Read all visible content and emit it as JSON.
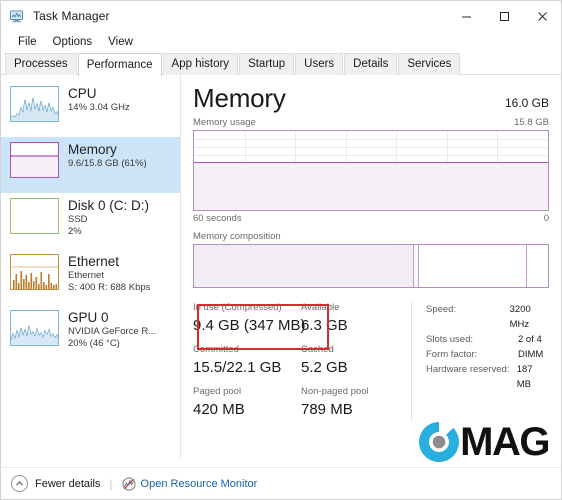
{
  "window": {
    "title": "Task Manager",
    "icon": "task-manager-icon",
    "minimize": "─",
    "maximize": "☐",
    "close": "✕"
  },
  "menu": [
    "File",
    "Options",
    "View"
  ],
  "tabs": [
    {
      "label": "Processes",
      "active": false
    },
    {
      "label": "Performance",
      "active": true
    },
    {
      "label": "App history",
      "active": false
    },
    {
      "label": "Startup",
      "active": false
    },
    {
      "label": "Users",
      "active": false
    },
    {
      "label": "Details",
      "active": false
    },
    {
      "label": "Services",
      "active": false
    }
  ],
  "sidebar": {
    "items": [
      {
        "title": "CPU",
        "lines": [
          "14%  3.04 GHz"
        ],
        "color": "#3f8fc4",
        "selected": false,
        "graph": "line"
      },
      {
        "title": "Memory",
        "lines": [
          "9.6/15.8 GB (61%)"
        ],
        "color": "#a855b7",
        "selected": true,
        "graph": "memory"
      },
      {
        "title": "Disk 0 (C: D:)",
        "lines": [
          "SSD",
          "2%"
        ],
        "color": "#6aa84f",
        "selected": false,
        "graph": "empty"
      },
      {
        "title": "Ethernet",
        "lines": [
          "Ethernet",
          "S: 400 R: 688 Kbps"
        ],
        "color": "#c07a2c",
        "selected": false,
        "graph": "spikes"
      },
      {
        "title": "GPU 0",
        "lines": [
          "NVIDIA GeForce R...",
          "20%  (46 °C)"
        ],
        "color": "#3f8fc4",
        "selected": false,
        "graph": "line"
      }
    ]
  },
  "main": {
    "title": "Memory",
    "capacity": "16.0 GB",
    "usage_graph": {
      "label": "Memory usage",
      "max": "15.8 GB",
      "axis_left": "60 seconds",
      "axis_right": "0",
      "fill_percent": 61
    },
    "composition": {
      "label": "Memory composition",
      "segments": [
        {
          "name": "in-use",
          "percent": 62.0,
          "color": "#f2edf5"
        },
        {
          "name": "modified",
          "percent": 1.0,
          "color": "#faf7fb"
        },
        {
          "name": "standby",
          "percent": 30.5,
          "color": "#ffffff"
        },
        {
          "name": "free",
          "percent": 6.5,
          "color": "#ffffff"
        }
      ]
    },
    "stats": {
      "in_use_label": "In use (Compressed)",
      "in_use_value": "9.4 GB (347 MB)",
      "available_label": "Available",
      "available_value": "6.3 GB",
      "committed_label": "Committed",
      "committed_value": "15.5/22.1 GB",
      "cached_label": "Cached",
      "cached_value": "5.2 GB",
      "paged_label": "Paged pool",
      "paged_value": "420 MB",
      "nonpaged_label": "Non-paged pool",
      "nonpaged_value": "789 MB",
      "highlight_color": "#d92b2b"
    },
    "info": [
      {
        "key": "Speed:",
        "value": "3200 MHz"
      },
      {
        "key": "Slots used:",
        "value": "2 of 4"
      },
      {
        "key": "Form factor:",
        "value": "DIMM"
      },
      {
        "key": "Hardware reserved:",
        "value": "187 MB"
      }
    ]
  },
  "watermark": {
    "mark": "C",
    "text": "MAG",
    "ring_color": "#29aee0",
    "dot_color": "#8c8c8c"
  },
  "footer": {
    "fewer_details": "Fewer details",
    "separator": "|",
    "open_resource_monitor": "Open Resource Monitor",
    "link_color": "#1763b0"
  }
}
